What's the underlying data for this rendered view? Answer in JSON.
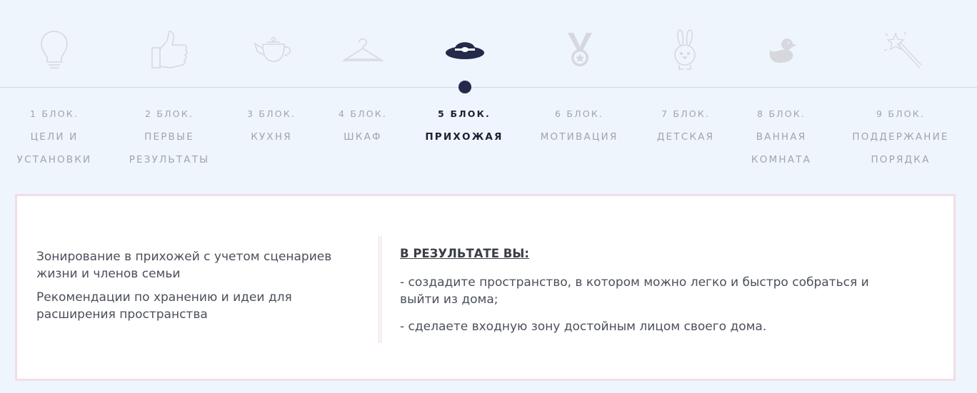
{
  "colors": {
    "background": "#eff5fd",
    "active": "#25294a",
    "inactive_icon": "#d6d8dd",
    "card_border": "#f2dde9"
  },
  "timeline": {
    "active_index": 4,
    "blocks": [
      {
        "number": "1 БЛОК.",
        "title_lines": [
          "ЦЕЛИ И",
          "УСТАНОВКИ"
        ],
        "icon": "lightbulb-icon"
      },
      {
        "number": "2 БЛОК.",
        "title_lines": [
          "ПЕРВЫЕ",
          "РЕЗУЛЬТАТЫ"
        ],
        "icon": "thumbs-up-icon"
      },
      {
        "number": "3 БЛОК.",
        "title_lines": [
          "КУХНЯ"
        ],
        "icon": "teapot-icon"
      },
      {
        "number": "4 БЛОК.",
        "title_lines": [
          "ШКАФ"
        ],
        "icon": "hanger-icon"
      },
      {
        "number": "5 БЛОК.",
        "title_lines": [
          "ПРИХОЖАЯ"
        ],
        "icon": "hat-icon"
      },
      {
        "number": "6 БЛОК.",
        "title_lines": [
          "МОТИВАЦИЯ"
        ],
        "icon": "medal-icon"
      },
      {
        "number": "7 БЛОК.",
        "title_lines": [
          "ДЕТСКАЯ"
        ],
        "icon": "bunny-icon"
      },
      {
        "number": "8 БЛОК.",
        "title_lines": [
          "ВАННАЯ",
          "КОМНАТА"
        ],
        "icon": "rubber-duck-icon"
      },
      {
        "number": "9 БЛОК.",
        "title_lines": [
          "ПОДДЕРЖАНИЕ",
          "ПОРЯДКА"
        ],
        "icon": "magic-wand-icon"
      }
    ]
  },
  "card": {
    "left_items": [
      "Зонирование в прихожей с учетом сценариев жизни и членов семьи",
      "Рекомендации по хранению и идеи для расширения пространства"
    ],
    "result_heading": "В РЕЗУЛЬТАТЕ ВЫ:",
    "result_items": [
      "- создадите пространство, в котором можно легко и быстро собраться и выйти из дома;",
      "- сделаете входную зону достойным лицом своего дома."
    ]
  }
}
